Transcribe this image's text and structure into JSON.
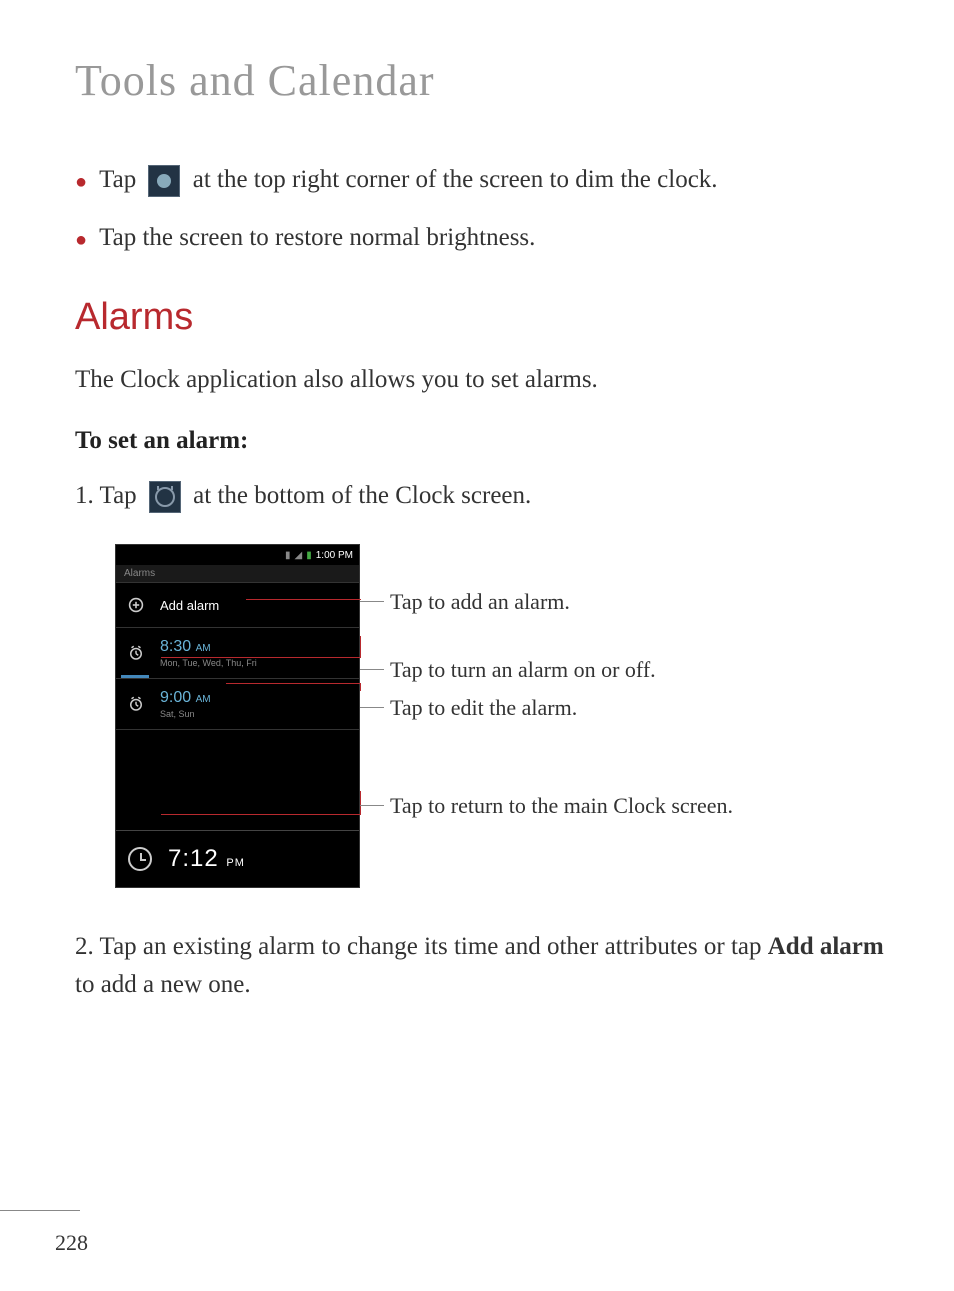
{
  "page_title": "Tools and Calendar",
  "bullet_1_pre": "Tap ",
  "bullet_1_post": " at the top right corner of the screen to dim the clock.",
  "bullet_2": "Tap the screen to restore normal brightness.",
  "section_header": "Alarms",
  "intro_text": "The Clock application also allows you to set alarms.",
  "sub_header": "To set an alarm:",
  "step_1_pre": "1. Tap ",
  "step_1_post": " at the bottom of the Clock screen.",
  "step_2_pre": "2. Tap an existing alarm to change its time and other attributes or tap ",
  "step_2_bold": "Add alarm",
  "step_2_post": " to add a new one.",
  "phone": {
    "status_time": "1:00 PM",
    "screen_label": "Alarms",
    "add_alarm_label": "Add alarm",
    "alarm_1": {
      "time": "8:30",
      "ampm": "AM",
      "days": "Mon, Tue, Wed, Thu, Fri"
    },
    "alarm_2": {
      "time": "9:00",
      "ampm": "AM",
      "days": "Sat, Sun"
    },
    "footer_time": "7:12",
    "footer_ampm": "PM"
  },
  "callouts": {
    "add": "Tap to add an alarm.",
    "toggle": "Tap to turn an alarm on or off.",
    "edit": "Tap to edit the alarm.",
    "return": "Tap to return to the main Clock screen."
  },
  "page_number": "228"
}
